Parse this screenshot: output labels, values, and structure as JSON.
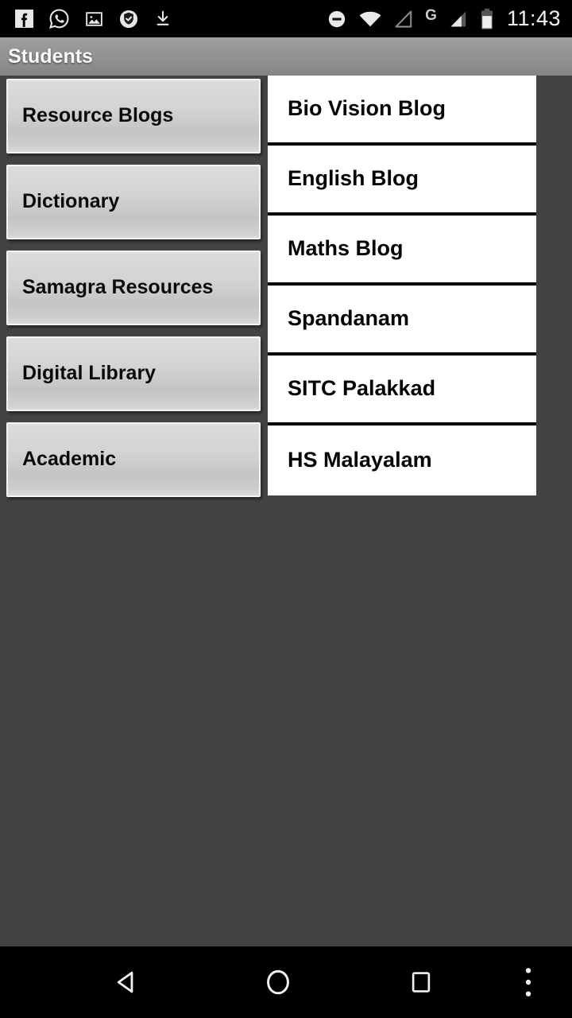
{
  "statusbar": {
    "time": "11:43",
    "left_icons": [
      {
        "name": "facebook-icon",
        "glyph": "f"
      },
      {
        "name": "whatsapp-icon",
        "glyph": "whatsapp"
      },
      {
        "name": "screenshot-image-icon",
        "glyph": "image"
      },
      {
        "name": "security-shield-icon",
        "glyph": "shield-check"
      },
      {
        "name": "download-icon",
        "glyph": "download-arrow"
      }
    ],
    "right_icons": [
      {
        "name": "do-not-disturb-icon",
        "glyph": "circle-minus"
      },
      {
        "name": "wifi-icon",
        "glyph": "wifi-full"
      },
      {
        "name": "signal-empty-icon",
        "glyph": "signal-triangle-outline"
      },
      {
        "name": "mobile-network-type-icon",
        "glyph": "G"
      },
      {
        "name": "signal-strength-icon",
        "glyph": "signal-triangle-filled"
      },
      {
        "name": "battery-icon",
        "glyph": "battery-partial"
      }
    ]
  },
  "titlebar": {
    "title": "Students"
  },
  "menu": {
    "items": [
      {
        "label": "Resource Blogs"
      },
      {
        "label": "Dictionary"
      },
      {
        "label": "Samagra Resources"
      },
      {
        "label": "Digital Library"
      },
      {
        "label": "Academic"
      }
    ]
  },
  "list": {
    "items": [
      {
        "label": "Bio Vision Blog"
      },
      {
        "label": "English Blog"
      },
      {
        "label": "Maths Blog"
      },
      {
        "label": "Spandanam"
      },
      {
        "label": "SITC Palakkad"
      },
      {
        "label": "HS Malayalam"
      }
    ]
  },
  "navbar": {
    "back": "back-button",
    "home": "home-button",
    "recents": "recents-button",
    "overflow": "overflow-menu-button"
  },
  "colors": {
    "background": "#434343",
    "titlebar_top": "#9e9e9e",
    "titlebar_bottom": "#858585",
    "list_background": "#ffffff",
    "divider": "#000000",
    "statusbar": "#000000"
  }
}
